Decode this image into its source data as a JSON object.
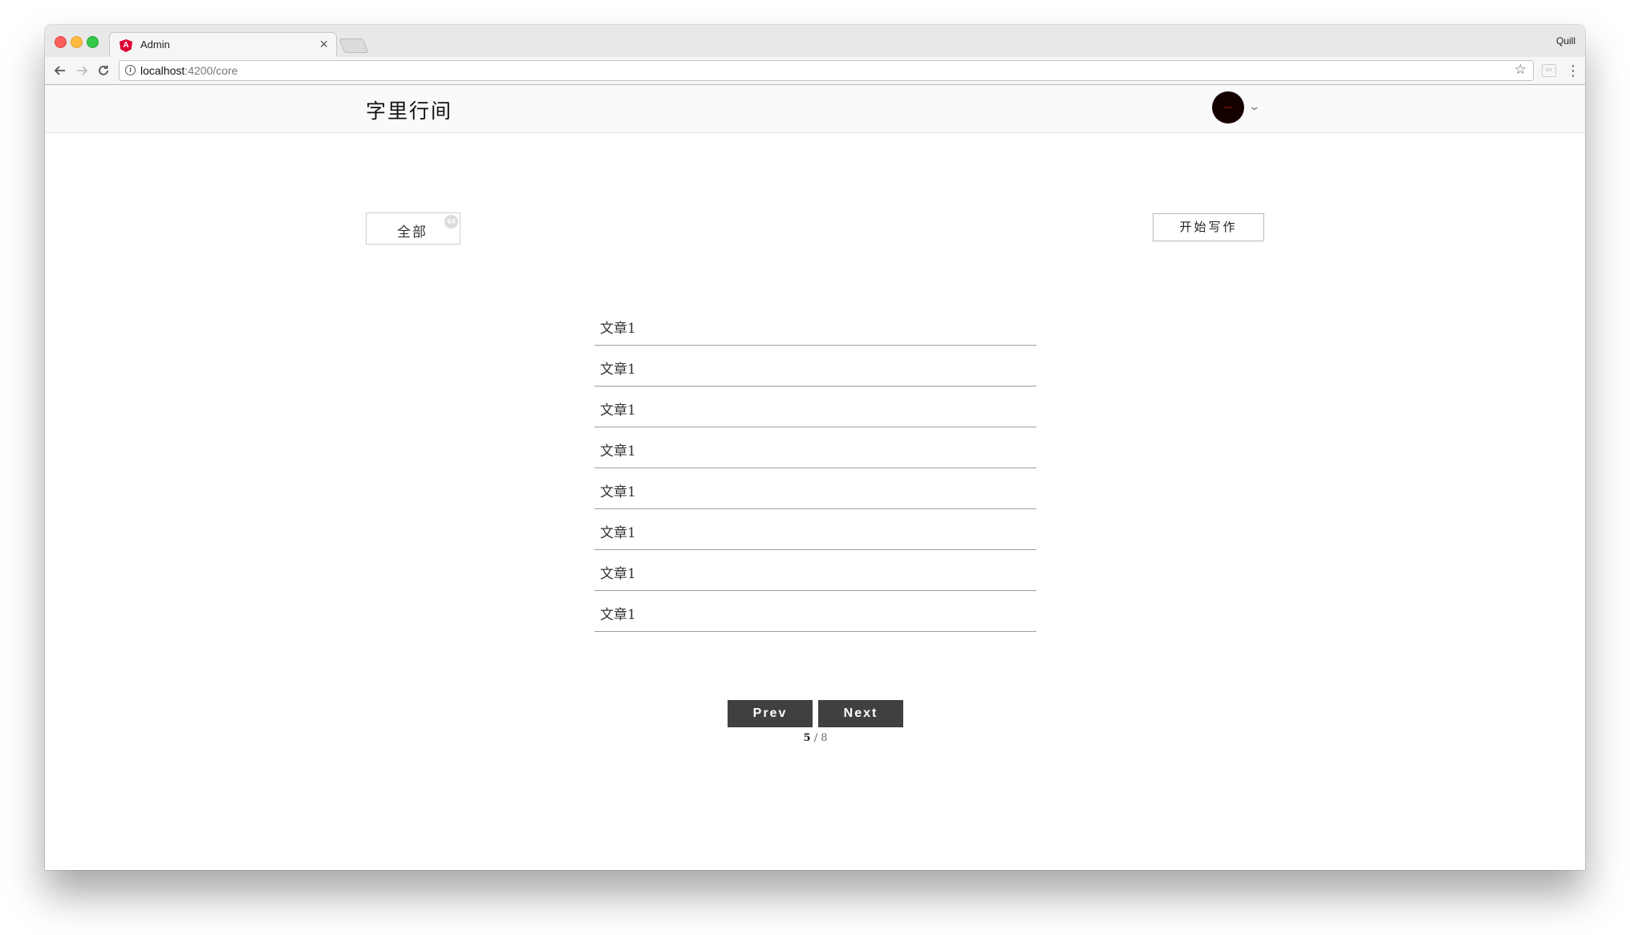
{
  "browser": {
    "tab_title": "Admin",
    "tab_close": "×",
    "profile_name": "Quill",
    "url_host": "localhost",
    "url_path": ":4200/core",
    "icons": {
      "favicon": "angular-icon",
      "back": "arrow-left-icon",
      "forward": "arrow-right-icon",
      "reload": "reload-icon",
      "info": "info-icon",
      "bookmark": "star-icon",
      "menu": "kebab-menu-icon"
    }
  },
  "header": {
    "brand": "字里行间",
    "avatar_icon": "avatar-icon",
    "dropdown_icon": "chevron-down-icon"
  },
  "toolbar": {
    "filter_label": "全部",
    "filter_count": "64",
    "write_label": "开始写作"
  },
  "articles": [
    {
      "title": "文章1"
    },
    {
      "title": "文章1"
    },
    {
      "title": "文章1"
    },
    {
      "title": "文章1"
    },
    {
      "title": "文章1"
    },
    {
      "title": "文章1"
    },
    {
      "title": "文章1"
    },
    {
      "title": "文章1"
    }
  ],
  "pagination": {
    "prev_label": "Prev",
    "next_label": "Next",
    "current": "5",
    "separator": "/",
    "total": "8"
  },
  "colors": {
    "button_dark": "#404040",
    "header_bg": "#fafafa",
    "divider": "#9e9e9e"
  }
}
